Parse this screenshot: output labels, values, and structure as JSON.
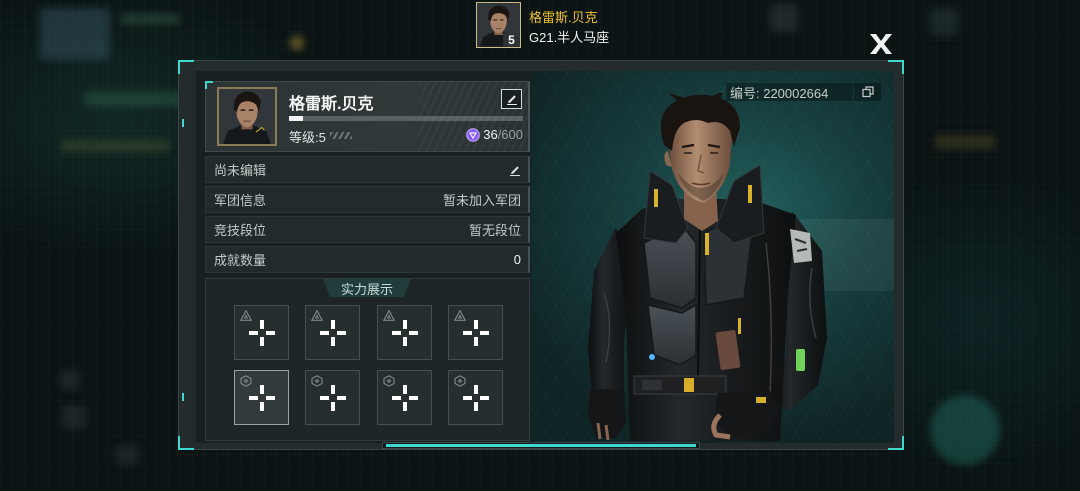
{
  "header": {
    "avatar_level": "5",
    "player_name": "格雷斯.贝克",
    "server_name": "G21.半人马座"
  },
  "profile": {
    "name": "格雷斯.贝克",
    "exp_progress": 0.06,
    "level_label": "等级:5",
    "exp_current": "36",
    "exp_total": "/600"
  },
  "info_rows": [
    {
      "label": "尚未编辑"
    },
    {
      "label": "军团信息",
      "value": "暂未加入军团"
    },
    {
      "label": "竞技段位",
      "value": "暂无段位"
    },
    {
      "label": "成就数量",
      "value": "0"
    }
  ],
  "showcase": {
    "title": "实力展示",
    "slots": [
      {
        "badge_icon": "triangle-badge-icon",
        "selected": false
      },
      {
        "badge_icon": "triangle-badge-icon",
        "selected": false
      },
      {
        "badge_icon": "triangle-badge-icon",
        "selected": false
      },
      {
        "badge_icon": "triangle-badge-icon",
        "selected": false
      },
      {
        "badge_icon": "hexagon-badge-icon",
        "selected": true
      },
      {
        "badge_icon": "hexagon-badge-icon",
        "selected": false
      },
      {
        "badge_icon": "hexagon-badge-icon",
        "selected": false
      },
      {
        "badge_icon": "hexagon-badge-icon",
        "selected": false
      }
    ]
  },
  "character": {
    "id_label": "编号: 220002664"
  },
  "icons": {
    "close": "close-x-icon",
    "edit": "pencil-icon",
    "exp": "purple-gem-icon",
    "copy": "copy-icon",
    "slot_add": "add-cross-icon"
  },
  "colors": {
    "accent_cyan": "#3fd8d0",
    "name_gold": "#f2c12e",
    "gem_purple": "#8b5cf6",
    "selected_slot_border": "#9aa3a4"
  }
}
